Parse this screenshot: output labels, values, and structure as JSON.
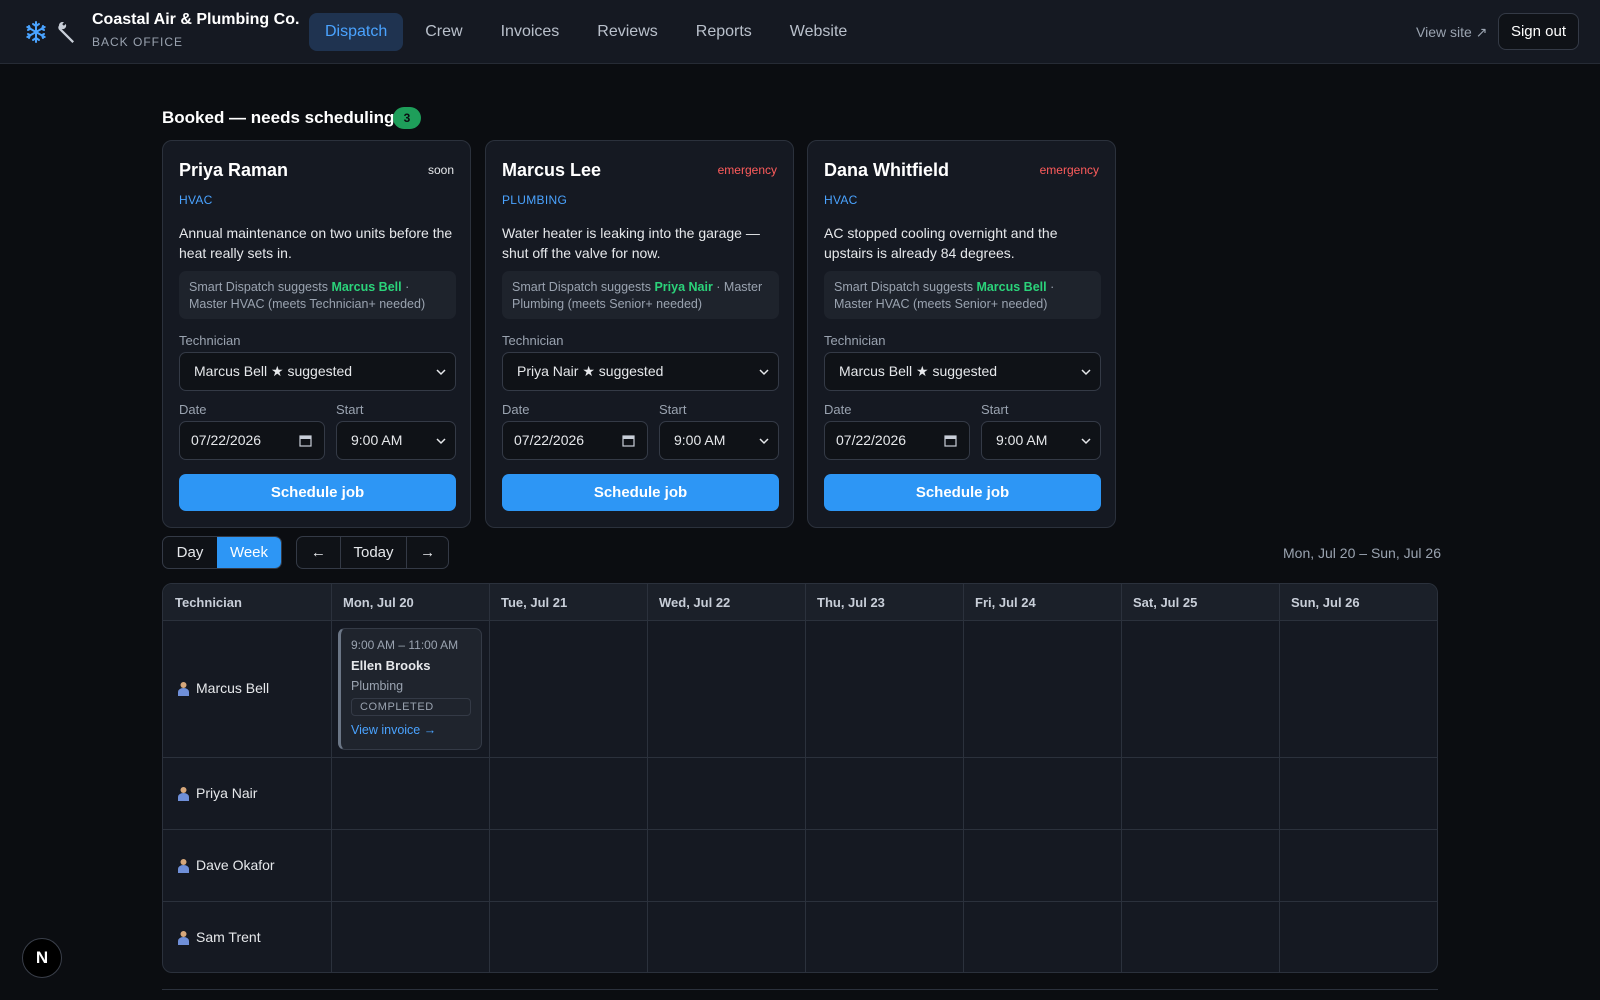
{
  "app": {
    "name": "Coastal Air & Plumbing Co.",
    "subtitle": "BACK OFFICE",
    "icons": [
      "snowflake-icon",
      "wrench-icon"
    ],
    "accent": "#2d96f5",
    "success": "#2bd37a",
    "danger": "#ff5c5c"
  },
  "nav": {
    "tabs": [
      {
        "label": "Dispatch",
        "active": true
      },
      {
        "label": "Crew",
        "active": false
      },
      {
        "label": "Invoices",
        "active": false
      },
      {
        "label": "Reviews",
        "active": false
      },
      {
        "label": "Reports",
        "active": false
      },
      {
        "label": "Website",
        "active": false
      }
    ],
    "view_site": "View site ↗",
    "sign_out": "Sign out"
  },
  "booked": {
    "title": "Booked — needs scheduling",
    "count": "3",
    "cards": [
      {
        "customer": "Priya Raman",
        "priority": "soon",
        "trade": "HVAC",
        "description": "Annual maintenance on two units before the heat really sets in.",
        "suggest_prefix": "Smart Dispatch suggests",
        "suggest_tech": "Marcus Bell",
        "suggest_detail": "· Master HVAC (meets Technician+ needed)",
        "technician_label": "Technician",
        "technician_value": "Marcus Bell ★ suggested",
        "date_label": "Date",
        "date_value": "07/22/2026",
        "start_label": "Start",
        "start_value": "9:00 AM",
        "button": "Schedule job"
      },
      {
        "customer": "Marcus Lee",
        "priority": "emergency",
        "trade": "PLUMBING",
        "description": "Water heater is leaking into the garage — shut off the valve for now.",
        "suggest_prefix": "Smart Dispatch suggests",
        "suggest_tech": "Priya Nair",
        "suggest_detail": "· Master Plumbing (meets Senior+ needed)",
        "technician_label": "Technician",
        "technician_value": "Priya Nair ★ suggested",
        "date_label": "Date",
        "date_value": "07/22/2026",
        "start_label": "Start",
        "start_value": "9:00 AM",
        "button": "Schedule job"
      },
      {
        "customer": "Dana Whitfield",
        "priority": "emergency",
        "trade": "HVAC",
        "description": "AC stopped cooling overnight and the upstairs is already 84 degrees.",
        "suggest_prefix": "Smart Dispatch suggests",
        "suggest_tech": "Marcus Bell",
        "suggest_detail": "· Master HVAC (meets Senior+ needed)",
        "technician_label": "Technician",
        "technician_value": "Marcus Bell ★ suggested",
        "date_label": "Date",
        "date_value": "07/22/2026",
        "start_label": "Start",
        "start_value": "9:00 AM",
        "button": "Schedule job"
      }
    ]
  },
  "calendar": {
    "view_day": "Day",
    "view_week": "Week",
    "active_view": "Week",
    "prev": "←",
    "today": "Today",
    "next": "→",
    "range": "Mon, Jul 20 – Sun, Jul 26",
    "header_technician": "Technician",
    "days": [
      "Mon, Jul 20",
      "Tue, Jul 21",
      "Wed, Jul 22",
      "Thu, Jul 23",
      "Fri, Jul 24",
      "Sat, Jul 25",
      "Sun, Jul 26"
    ],
    "technicians": [
      "Marcus Bell",
      "Priya Nair",
      "Dave Okafor",
      "Sam Trent"
    ],
    "job": {
      "time": "9:00 AM – 11:00 AM",
      "customer": "Ellen Brooks",
      "service": "Plumbing",
      "status": "COMPLETED",
      "link": "View invoice →"
    }
  },
  "badge": "N"
}
